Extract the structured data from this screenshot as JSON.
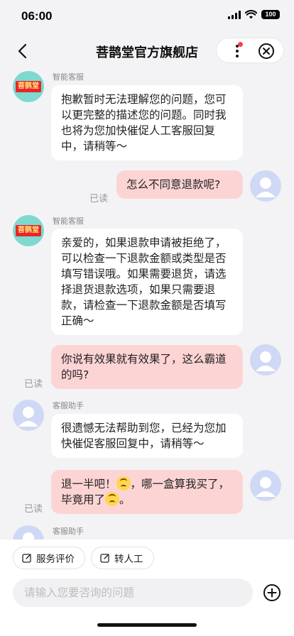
{
  "status_bar": {
    "time": "06:00",
    "battery": "100"
  },
  "header": {
    "title": "菩鹊堂官方旗舰店"
  },
  "brand": {
    "avatar_text": "菩鹊堂"
  },
  "messages": [
    {
      "sender": "智能客服",
      "text": "抱歉暂时无法理解您的问题，您可以更完整的描述您的问题。同时我也将为您加快催促人工客服回复中，请稍等～"
    },
    {
      "text": "怎么不同意退款呢?",
      "read": "已读"
    },
    {
      "sender": "智能客服",
      "text": "亲爱的，如果退款申请被拒绝了，可以检查一下退款金额或类型是否填写错误哦。如果需要退货，请选择退货退款选项，如果只需要退款，请检查一下退款金额是否填写正确～"
    },
    {
      "text": "你说有效果就有效果了，这么霸道的吗?",
      "read": "已读"
    },
    {
      "sender": "客服助手",
      "text": "很遗憾无法帮助到您，已经为您加快催促客服回复中，请稍等～"
    },
    {
      "text_a": "退一半吧！",
      "text_b": "，哪一盒算我买了，毕竟用了",
      "text_c": "。",
      "read": "已读"
    },
    {
      "sender": "客服助手"
    }
  ],
  "bottom": {
    "quick_actions": [
      "服务评价",
      "转人工"
    ],
    "input_placeholder": "请输入您要咨询的问题"
  },
  "colors": {
    "accent_dot": "#ff3b52",
    "user_bubble": "#fdd4d4",
    "brand_avatar_bg": "#7ed9cf"
  }
}
